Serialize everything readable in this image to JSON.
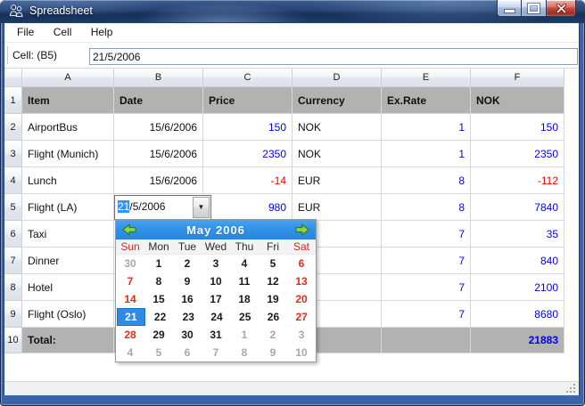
{
  "window": {
    "title": "Spreadsheet"
  },
  "menu": {
    "items": [
      "File",
      "Cell",
      "Help"
    ]
  },
  "toolbar": {
    "cell_label": "Cell: (B5)",
    "cell_value": "21/5/2006"
  },
  "spreadsheet": {
    "column_headers": [
      "A",
      "B",
      "C",
      "D",
      "E",
      "F"
    ],
    "rows": [
      {
        "h": "1",
        "bg": "header",
        "cells": [
          {
            "t": "Item",
            "a": "left",
            "b": true
          },
          {
            "t": "Date",
            "a": "left",
            "b": true
          },
          {
            "t": "Price",
            "a": "left",
            "b": true
          },
          {
            "t": "Currency",
            "a": "left",
            "b": true
          },
          {
            "t": "Ex.Rate",
            "a": "left",
            "b": true
          },
          {
            "t": "NOK",
            "a": "left",
            "b": true
          }
        ]
      },
      {
        "h": "2",
        "cells": [
          {
            "t": "AirportBus"
          },
          {
            "t": "15/6/2006"
          },
          {
            "t": "150",
            "c": "blue"
          },
          {
            "t": "NOK"
          },
          {
            "t": "1",
            "c": "blue"
          },
          {
            "t": "150",
            "c": "blue"
          }
        ]
      },
      {
        "h": "3",
        "cells": [
          {
            "t": "Flight (Munich)"
          },
          {
            "t": "15/6/2006"
          },
          {
            "t": "2350",
            "c": "blue"
          },
          {
            "t": "NOK"
          },
          {
            "t": "1",
            "c": "blue"
          },
          {
            "t": "2350",
            "c": "blue"
          }
        ]
      },
      {
        "h": "4",
        "cells": [
          {
            "t": "Lunch"
          },
          {
            "t": "15/6/2006"
          },
          {
            "t": "-14",
            "c": "red"
          },
          {
            "t": "EUR"
          },
          {
            "t": "8",
            "c": "blue"
          },
          {
            "t": "-112",
            "c": "red"
          }
        ]
      },
      {
        "h": "5",
        "cells": [
          {
            "t": "Flight (LA)"
          },
          {
            "t": ""
          },
          {
            "t": "980",
            "c": "blue"
          },
          {
            "t": "EUR"
          },
          {
            "t": "8",
            "c": "blue"
          },
          {
            "t": "7840",
            "c": "blue"
          }
        ]
      },
      {
        "h": "6",
        "cells": [
          {
            "t": "Taxi"
          },
          {
            "t": ""
          },
          {
            "t": ""
          },
          {
            "t": ""
          },
          {
            "t": "7",
            "c": "blue"
          },
          {
            "t": "35",
            "c": "blue"
          }
        ]
      },
      {
        "h": "7",
        "cells": [
          {
            "t": "Dinner"
          },
          {
            "t": ""
          },
          {
            "t": ""
          },
          {
            "t": ""
          },
          {
            "t": "7",
            "c": "blue"
          },
          {
            "t": "840",
            "c": "blue"
          }
        ]
      },
      {
        "h": "8",
        "cells": [
          {
            "t": "Hotel"
          },
          {
            "t": ""
          },
          {
            "t": ""
          },
          {
            "t": ""
          },
          {
            "t": "7",
            "c": "blue"
          },
          {
            "t": "2100",
            "c": "blue"
          }
        ]
      },
      {
        "h": "9",
        "cells": [
          {
            "t": "Flight (Oslo)"
          },
          {
            "t": ""
          },
          {
            "t": ""
          },
          {
            "t": ""
          },
          {
            "t": "7",
            "c": "blue"
          },
          {
            "t": "8680",
            "c": "blue"
          }
        ]
      },
      {
        "h": "10",
        "bg": "header",
        "cells": [
          {
            "t": "Total:",
            "a": "left",
            "b": true
          },
          {
            "t": ""
          },
          {
            "t": ""
          },
          {
            "t": ""
          },
          {
            "t": ""
          },
          {
            "t": "21883",
            "c": "blue"
          }
        ]
      }
    ]
  },
  "date_editor": {
    "selected_part": "21",
    "rest_part": "/5/2006"
  },
  "calendar": {
    "title": "May 2006",
    "weekdays": [
      {
        "t": "Sun",
        "c": "red"
      },
      {
        "t": "Mon"
      },
      {
        "t": "Tue"
      },
      {
        "t": "Wed"
      },
      {
        "t": "Thu"
      },
      {
        "t": "Fri"
      },
      {
        "t": "Sat",
        "c": "red"
      }
    ],
    "weeks": [
      [
        {
          "t": "30",
          "c": "dim"
        },
        {
          "t": "1"
        },
        {
          "t": "2"
        },
        {
          "t": "3"
        },
        {
          "t": "4"
        },
        {
          "t": "5"
        },
        {
          "t": "6",
          "c": "red"
        }
      ],
      [
        {
          "t": "7",
          "c": "red"
        },
        {
          "t": "8"
        },
        {
          "t": "9"
        },
        {
          "t": "10"
        },
        {
          "t": "11"
        },
        {
          "t": "12"
        },
        {
          "t": "13",
          "c": "red"
        }
      ],
      [
        {
          "t": "14",
          "c": "red"
        },
        {
          "t": "15"
        },
        {
          "t": "16"
        },
        {
          "t": "17"
        },
        {
          "t": "18"
        },
        {
          "t": "19"
        },
        {
          "t": "20",
          "c": "red"
        }
      ],
      [
        {
          "t": "21",
          "c": "selected"
        },
        {
          "t": "22"
        },
        {
          "t": "23"
        },
        {
          "t": "24"
        },
        {
          "t": "25"
        },
        {
          "t": "26"
        },
        {
          "t": "27",
          "c": "red"
        }
      ],
      [
        {
          "t": "28",
          "c": "red"
        },
        {
          "t": "29"
        },
        {
          "t": "30"
        },
        {
          "t": "31"
        },
        {
          "t": "1",
          "c": "dim"
        },
        {
          "t": "2",
          "c": "dim"
        },
        {
          "t": "3",
          "c": "dim"
        }
      ],
      [
        {
          "t": "4",
          "c": "dim"
        },
        {
          "t": "5",
          "c": "dim"
        },
        {
          "t": "6",
          "c": "dim"
        },
        {
          "t": "7",
          "c": "dim"
        },
        {
          "t": "8",
          "c": "dim"
        },
        {
          "t": "9",
          "c": "dim"
        },
        {
          "t": "10",
          "c": "dim"
        }
      ]
    ]
  },
  "colors": {
    "value_blue": "#0000f0",
    "value_red": "#f00000",
    "header_row_gray": "#b2b2b2",
    "calendar_header_blue": "#2f91e8",
    "selected_day_blue": "#2e8ce6",
    "text_selection_blue": "#3094f0",
    "weekend_red": "#e8281a",
    "other_month_gray": "#a8a8a8"
  },
  "icons": {
    "app": "people-icon",
    "minimize": "minimize-icon",
    "maximize": "maximize-icon",
    "close": "close-icon",
    "dropdown": "chevron-down-icon",
    "prev": "green-left-arrow-icon",
    "next": "green-right-arrow-icon",
    "resize": "resize-grip-icon"
  }
}
